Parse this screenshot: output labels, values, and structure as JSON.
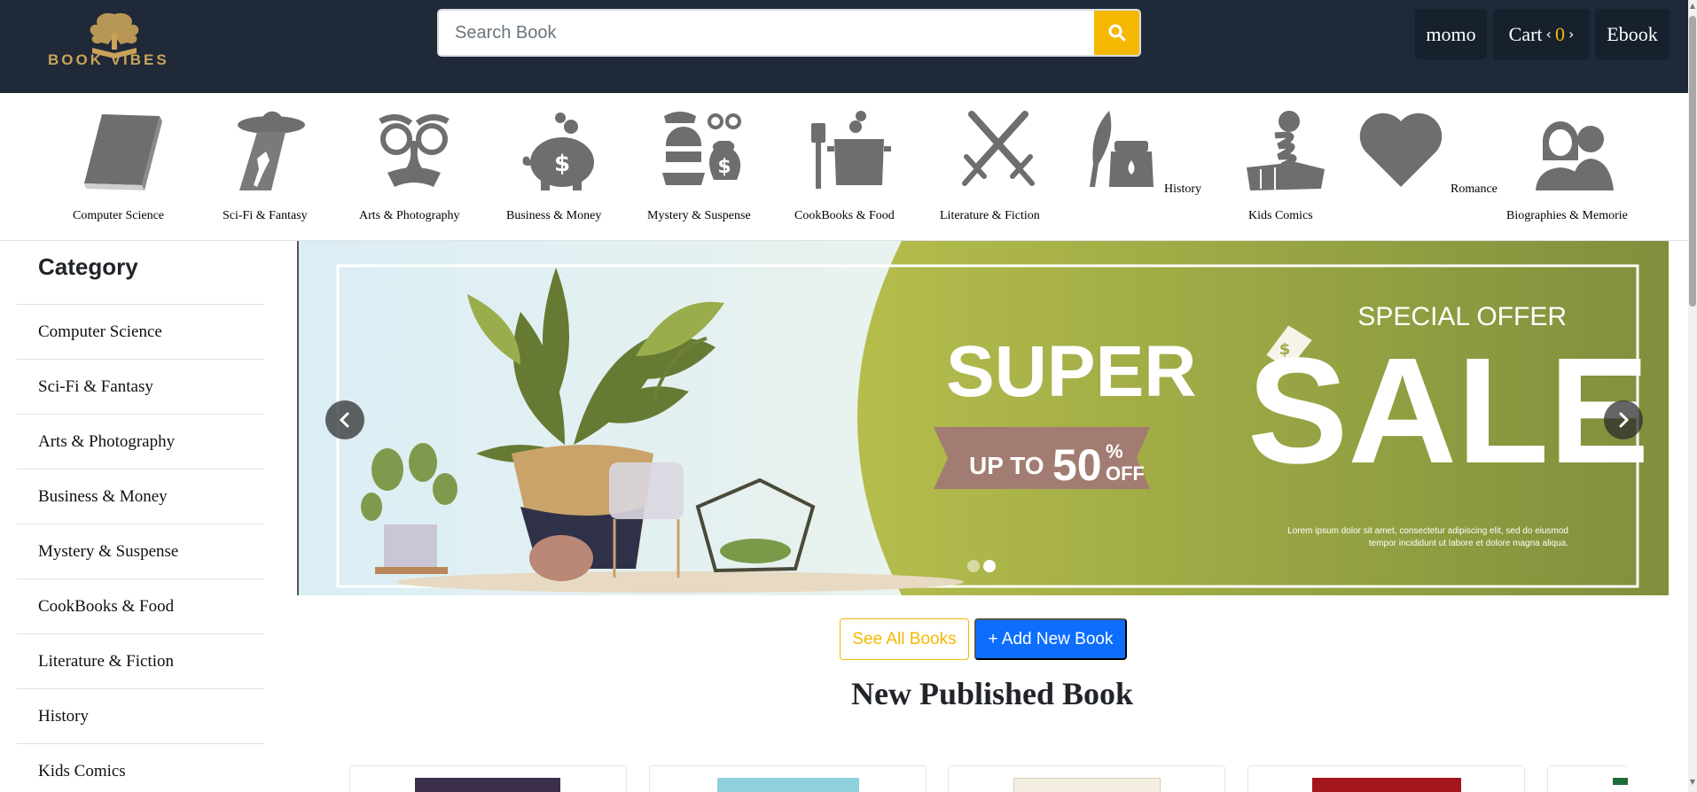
{
  "navbar": {
    "logo_text": "BOOK VIBES",
    "search": {
      "placeholder": "Search Book",
      "value": ""
    },
    "user_label": "momo",
    "cart_label": "Cart",
    "cart_count": "0",
    "ebook_label": "Ebook",
    "colors": {
      "background": "#1f2937",
      "accent": "#f5b800",
      "logo_gold": "#c9a25a"
    }
  },
  "categories": [
    {
      "label": "Computer Science",
      "icon": "book-icon"
    },
    {
      "label": "Sci-Fi & Fantasy",
      "icon": "ufo-icon"
    },
    {
      "label": "Arts & Photography",
      "icon": "disguise-mask-icon"
    },
    {
      "label": "Business & Money",
      "icon": "piggy-bank-icon"
    },
    {
      "label": "Mystery & Suspense",
      "icon": "thief-icon"
    },
    {
      "label": "CookBooks & Food",
      "icon": "cooking-pot-icon"
    },
    {
      "label": "Literature & Fiction",
      "icon": "crossed-swords-icon"
    },
    {
      "label": "History",
      "icon": "quill-inkwell-icon"
    },
    {
      "label": "Kids Comics",
      "icon": "jack-in-the-box-icon"
    },
    {
      "label": "Romance",
      "icon": "heart-icon"
    },
    {
      "label": "Biographies & Memorie",
      "icon": "people-icon"
    }
  ],
  "sidebar": {
    "title": "Category",
    "items": [
      "Computer Science",
      "Sci-Fi & Fantasy",
      "Arts & Photography",
      "Business & Money",
      "Mystery & Suspense",
      "CookBooks & Food",
      "Literature & Fiction",
      "History",
      "Kids Comics"
    ]
  },
  "banner": {
    "offer": "SPECIAL OFFER",
    "super": "SUPER",
    "sale": "SALE",
    "discount_prefix": "UP TO",
    "discount_value": "50",
    "discount_percent": "%",
    "discount_suffix": "OFF",
    "tag_symbol": "$",
    "lorem_line1": "Lorem ipsum dolor sit amet, consectetur adipiscing elit, sed do eiusmod",
    "lorem_line2": "tempor incididunt ut labore et dolore magna aliqua.",
    "slide_count": 2,
    "active_slide": 2
  },
  "actions": {
    "see_all": "See All Books",
    "add_new": "+ Add New Book"
  },
  "section_title": "New Published Book",
  "books": [
    {
      "cover_color": "#3b2f4a"
    },
    {
      "cover_color": "#8fd0dc"
    },
    {
      "cover_color": "#f4efe2"
    },
    {
      "cover_color": "#a3161c"
    },
    {
      "cover_color": "#1e6b3a"
    }
  ]
}
